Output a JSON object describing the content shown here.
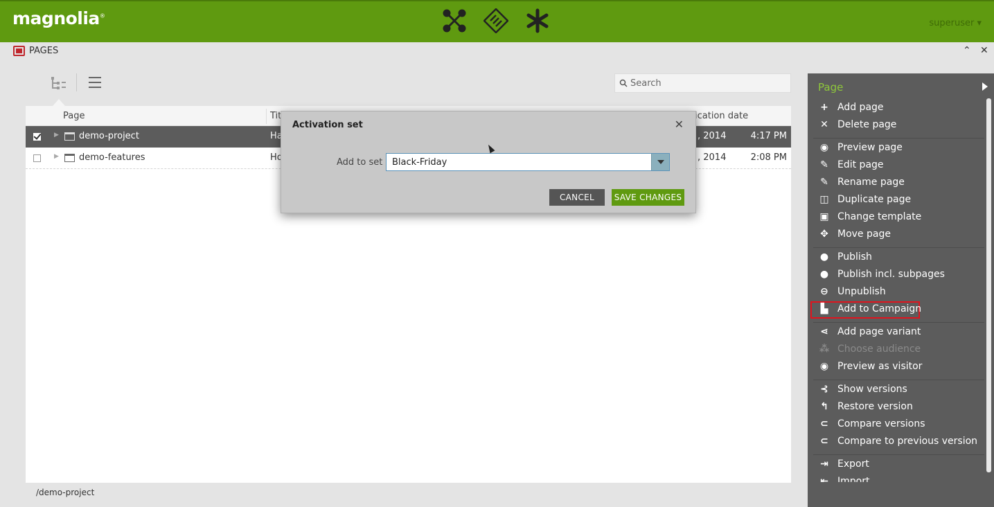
{
  "brand": {
    "logo": "magnolia",
    "trademark": "®",
    "accent_green": "#5f9a10",
    "highlight_red": "#e0141e"
  },
  "topbar": {
    "app_icons": [
      "pages-app-icon",
      "tools-app-icon",
      "favorites-app-icon"
    ],
    "user": "superuser"
  },
  "subheader": {
    "title": "PAGES"
  },
  "search": {
    "placeholder": "Search"
  },
  "grid": {
    "columns": {
      "page": "Page",
      "title": "Tit",
      "modification_date": "ication date"
    },
    "rows": [
      {
        "name": "demo-project",
        "title": "Ha",
        "date": ", 2014",
        "time": "4:17 PM",
        "selected": true
      },
      {
        "name": "demo-features",
        "title": "Ho",
        "date": ", 2014",
        "time": "2:08 PM",
        "selected": false
      }
    ]
  },
  "dialog": {
    "title": "Activation set",
    "field_label": "Add to set",
    "field_value": "Black-Friday",
    "cancel_label": "CANCEL",
    "save_label": "SAVE CHANGES"
  },
  "actionbar": {
    "title": "Page",
    "items": [
      {
        "label": "Add page",
        "icon": "plus-icon"
      },
      {
        "label": "Delete page",
        "icon": "x-icon"
      },
      {
        "label": "Preview page",
        "icon": "eye-icon"
      },
      {
        "label": "Edit page",
        "icon": "pencil-icon"
      },
      {
        "label": "Rename page",
        "icon": "pencil-icon"
      },
      {
        "label": "Duplicate page",
        "icon": "duplicate-icon"
      },
      {
        "label": "Change template",
        "icon": "template-icon"
      },
      {
        "label": "Move page",
        "icon": "move-icon"
      },
      {
        "label": "Publish",
        "icon": "publish-icon"
      },
      {
        "label": "Publish incl. subpages",
        "icon": "publish-subpages-icon"
      },
      {
        "label": "Unpublish",
        "icon": "unpublish-icon"
      },
      {
        "label": "Add to Campaign",
        "icon": "campaign-icon",
        "highlighted": true
      },
      {
        "label": "Add page variant",
        "icon": "variant-icon"
      },
      {
        "label": "Choose audience",
        "icon": "audience-icon",
        "disabled": true
      },
      {
        "label": "Preview as visitor",
        "icon": "eye-icon"
      },
      {
        "label": "Show versions",
        "icon": "versions-icon"
      },
      {
        "label": "Restore version",
        "icon": "restore-icon"
      },
      {
        "label": "Compare versions",
        "icon": "compare-icon"
      },
      {
        "label": "Compare to previous version",
        "icon": "compare-icon"
      },
      {
        "label": "Export",
        "icon": "export-icon"
      },
      {
        "label": "Import",
        "icon": "import-icon"
      }
    ]
  },
  "footer": {
    "path": "/demo-project"
  }
}
